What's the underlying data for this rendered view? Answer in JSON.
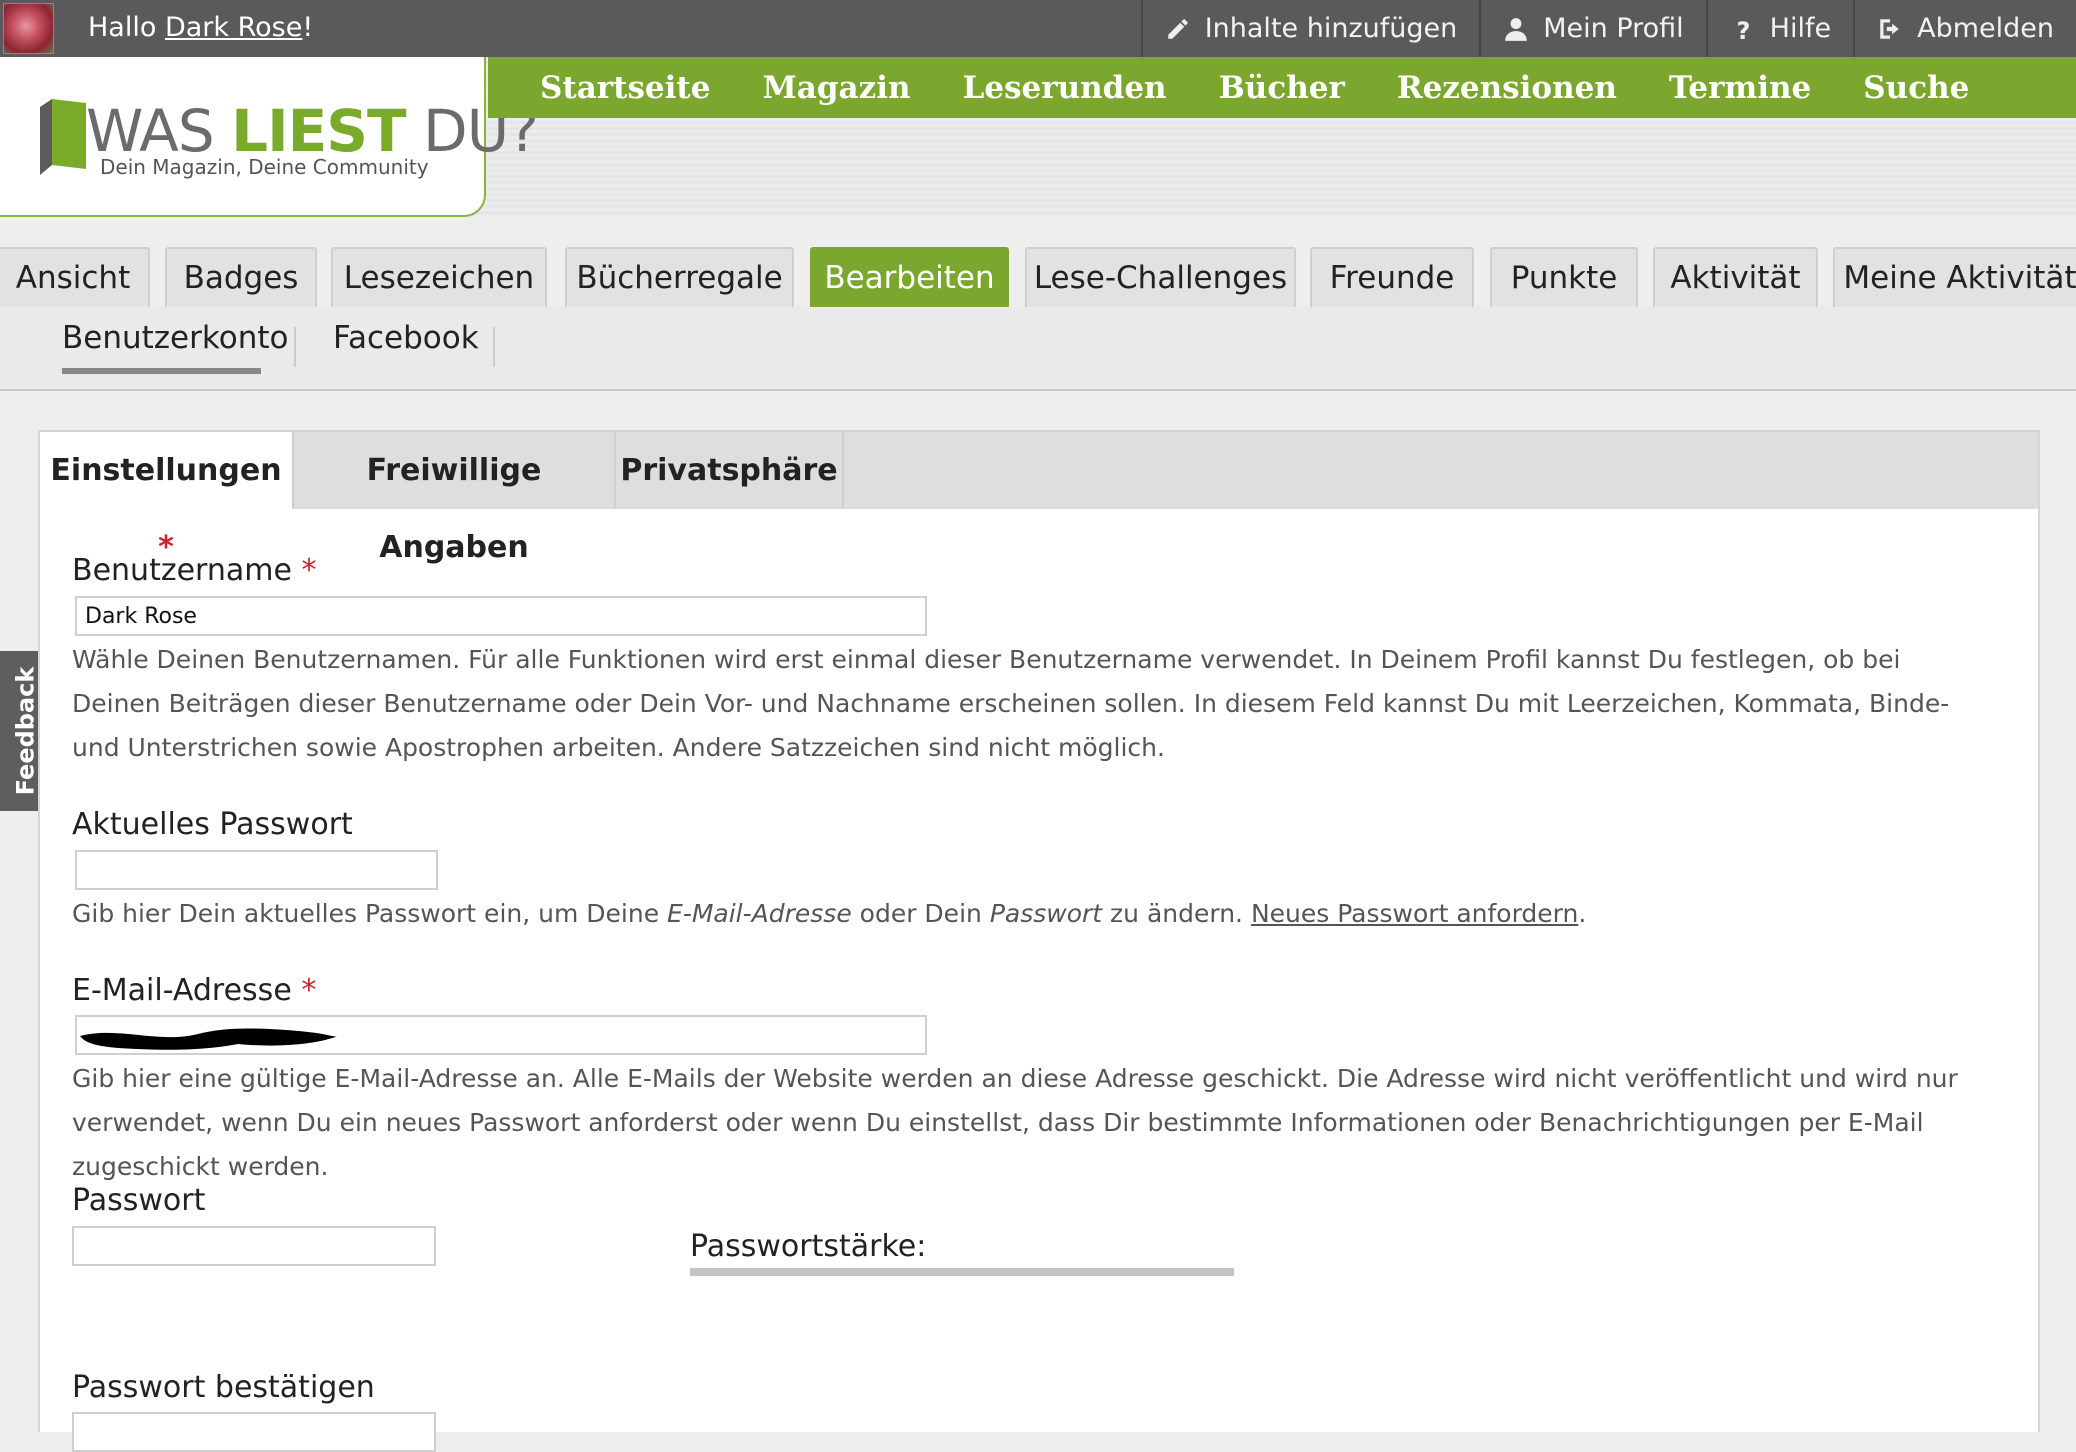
{
  "topbar": {
    "greeting_prefix": "Hallo ",
    "username": "Dark Rose",
    "greeting_suffix": "!",
    "actions": [
      "Inhalte hinzufügen",
      "Mein Profil",
      "Hilfe",
      "Abmelden"
    ],
    "action_icons": [
      "pencil-icon",
      "user-icon",
      "question-icon",
      "logout-icon"
    ]
  },
  "logo": {
    "was": "WAS ",
    "liest": "LIEST",
    "du": " DU?",
    "tagline": "Dein Magazin, Deine Community"
  },
  "mainnav": [
    "Startseite",
    "Magazin",
    "Leserunden",
    "Bücher",
    "Rezensionen",
    "Termine",
    "Suche"
  ],
  "tabs": [
    "Ansicht",
    "Badges",
    "Lesezeichen",
    "Bücherregale",
    "Bearbeiten",
    "Lese-Challenges",
    "Freunde",
    "Punkte",
    "Aktivität",
    "Meine Aktivität"
  ],
  "active_tab": "Bearbeiten",
  "subtabs": [
    "Benutzerkonto",
    "Facebook"
  ],
  "form_tabs": [
    "Einstellungen",
    "Freiwillige Angaben",
    "Privatsphäre"
  ],
  "required_mark": "*",
  "fields": {
    "username": {
      "label": "Benutzername",
      "value": "Dark Rose",
      "help": "Wähle Deinen Benutzernamen. Für alle Funktionen wird erst einmal dieser Benutzername verwendet. In Deinem Profil kannst Du festlegen, ob bei Deinen Beiträgen dieser Benutzername oder Dein Vor- und Nachname erscheinen sollen. In diesem Feld kannst Du mit Leerzeichen, Kommata, Binde- und Unterstrichen sowie Apostrophen arbeiten. Andere Satzzeichen sind nicht möglich."
    },
    "current_password": {
      "label": "Aktuelles Passwort",
      "help_1": "Gib hier Dein aktuelles Passwort ein, um Deine ",
      "help_em1": "E-Mail-Adresse",
      "help_2": " oder Dein ",
      "help_em2": "Passwort",
      "help_3": " zu ändern. ",
      "help_link": "Neues Passwort anfordern",
      "help_4": "."
    },
    "email": {
      "label": "E-Mail-Adresse",
      "help": "Gib hier eine gültige E-Mail-Adresse an. Alle E-Mails der Website werden an diese Adresse geschickt. Die Adresse wird nicht veröffentlicht und wird nur verwendet, wenn Du ein neues Passwort anforderst oder wenn Du einstellst, dass Dir bestimmte Informationen oder Benachrichtigungen per E-Mail zugeschickt werden."
    },
    "password": {
      "label": "Passwort",
      "strength_label": "Passwortstärke:"
    },
    "password_confirm": {
      "label": "Passwort bestätigen"
    }
  },
  "feedback": "Feedback",
  "colors": {
    "brand_green": "#7ba72f",
    "topbar": "#5a5a5c",
    "required": "#d0202a"
  }
}
